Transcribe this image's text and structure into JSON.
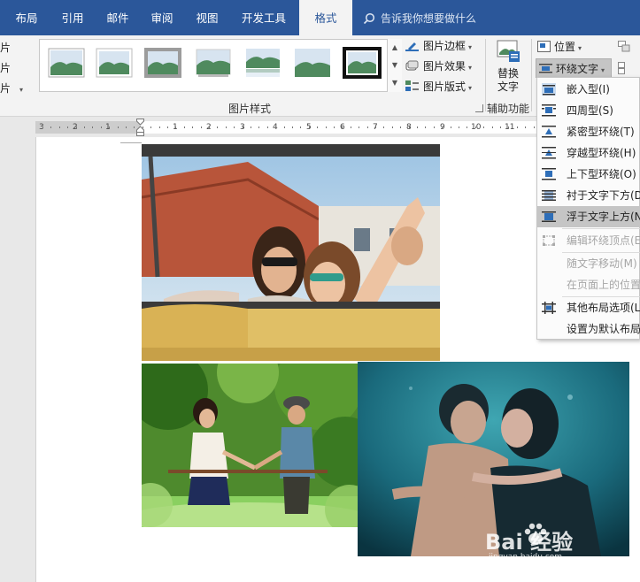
{
  "tabs": [
    {
      "label": "布局",
      "active": false
    },
    {
      "label": "引用",
      "active": false
    },
    {
      "label": "邮件",
      "active": false
    },
    {
      "label": "审阅",
      "active": false
    },
    {
      "label": "视图",
      "active": false
    },
    {
      "label": "开发工具",
      "active": false
    },
    {
      "label": "格式",
      "active": true
    }
  ],
  "tell_me": "告诉我你想要做什么",
  "ribbon": {
    "left_labels": [
      "片",
      "片",
      "片"
    ],
    "picture_styles_label": "图片样式",
    "picture_border": "图片边框",
    "picture_effects": "图片效果",
    "picture_layout": "图片版式",
    "alt_text_line1": "替换",
    "alt_text_line2": "文字",
    "accessibility_label": "辅助功能",
    "position": "位置",
    "wrap_text": "环绕文字",
    "right_cut": "选"
  },
  "ruler": {
    "numbers": [
      "3",
      "2",
      "1",
      "1",
      "2",
      "3",
      "4",
      "5",
      "6",
      "7",
      "8",
      "9",
      "10",
      "11"
    ]
  },
  "wrap_menu": {
    "items": [
      {
        "label": "嵌入型(I)",
        "icon": "wrap-inline-icon",
        "state": "normal"
      },
      {
        "label": "四周型(S)",
        "icon": "wrap-square-icon",
        "state": "normal"
      },
      {
        "label": "紧密型环绕(T)",
        "icon": "wrap-tight-icon",
        "state": "normal"
      },
      {
        "label": "穿越型环绕(H)",
        "icon": "wrap-through-icon",
        "state": "normal"
      },
      {
        "label": "上下型环绕(O)",
        "icon": "wrap-top-bottom-icon",
        "state": "normal"
      },
      {
        "label": "衬于文字下方(D)",
        "icon": "behind-text-icon",
        "state": "normal"
      },
      {
        "label": "浮于文字上方(N)",
        "icon": "in-front-of-text-icon",
        "state": "highlighted"
      },
      {
        "label": "编辑环绕顶点(E)",
        "icon": "edit-wrap-points-icon",
        "state": "disabled"
      },
      {
        "label": "随文字移动(M)",
        "icon": "",
        "state": "disabled"
      },
      {
        "label": "在页面上的位置固定(F)",
        "icon": "",
        "state": "disabled"
      },
      {
        "label": "其他布局选项(L)...",
        "icon": "more-layout-icon",
        "state": "normal"
      },
      {
        "label": "设置为默认布局(A)",
        "icon": "",
        "state": "normal"
      }
    ]
  },
  "watermark": {
    "main": "Bai 经验",
    "sub": "jingyan.baidu.com"
  },
  "colors": {
    "tabbar": "#2b579a",
    "ribbon": "#f3f3f3",
    "highlight": "#c5c5c5"
  }
}
